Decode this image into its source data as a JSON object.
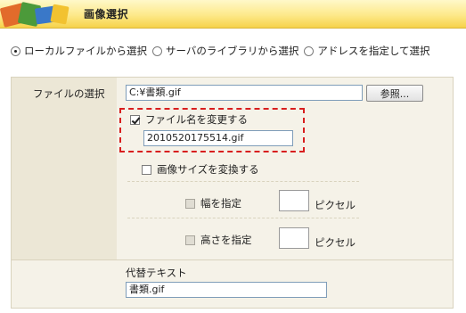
{
  "header": {
    "title": "画像選択"
  },
  "source_options": [
    {
      "label": "ローカルファイルから選択",
      "selected": true
    },
    {
      "label": "サーバのライブラリから選択",
      "selected": false
    },
    {
      "label": "アドレスを指定して選択",
      "selected": false
    }
  ],
  "file_select": {
    "label": "ファイルの選択",
    "value": "C:¥書類.gif",
    "browse_label": "参照..."
  },
  "rename": {
    "label": "ファイル名を変更する",
    "checked": true,
    "value": "2010520175514.gif"
  },
  "resize": {
    "label": "画像サイズを変換する",
    "checked": false,
    "width_label": "幅を指定",
    "width_unit": "ピクセル",
    "height_label": "高さを指定",
    "height_unit": "ピクセル"
  },
  "alt_text": {
    "label": "代替テキスト",
    "value": "書類.gif"
  },
  "colors": {
    "header": "#f6d24a",
    "highlight": "#d81e1e"
  }
}
